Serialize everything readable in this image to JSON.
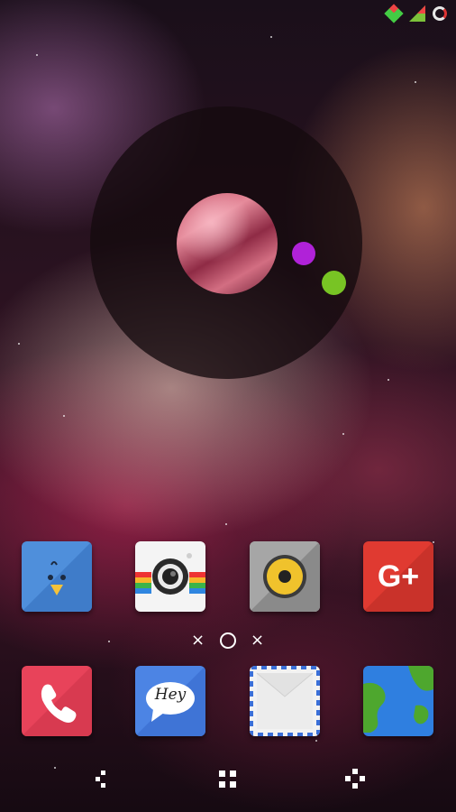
{
  "status_bar": {
    "icons": [
      "data-diamond-icon",
      "signal-icon",
      "battery-ring-icon"
    ]
  },
  "widget": {
    "dots": [
      {
        "color": "#b022d8"
      },
      {
        "color": "#78c424"
      }
    ]
  },
  "dock_row_1": [
    {
      "name": "bird-app-icon",
      "bg": "#4f8fdb"
    },
    {
      "name": "camera-app-icon",
      "bg": "#f4f4f4"
    },
    {
      "name": "speaker-app-icon",
      "bg": "#8a8a8a"
    },
    {
      "name": "google-plus-app-icon",
      "bg": "#e03a31",
      "text": "G+"
    }
  ],
  "pager": {
    "left": "×",
    "right": "×"
  },
  "dock_row_2": [
    {
      "name": "phone-app-icon",
      "bg": "#e8435a"
    },
    {
      "name": "hey-messaging-app-icon",
      "bg": "#4c84e4",
      "text": "Hey"
    },
    {
      "name": "mail-app-icon",
      "bg": "#f2f2f2"
    },
    {
      "name": "earth-app-icon",
      "bg": "#2f7fe0"
    }
  ],
  "nav": [
    "back-icon",
    "home-icon",
    "recents-icon"
  ]
}
